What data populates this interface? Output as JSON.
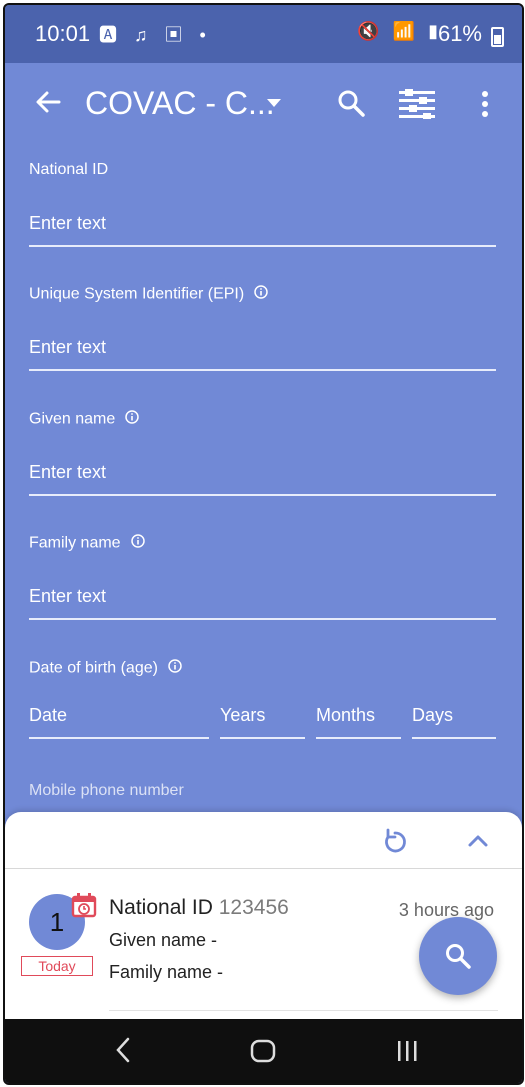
{
  "status": {
    "time": "10:01",
    "left_icons": "🅰 ♫ ▣ •",
    "right_icons": "🔇 📶 ▮",
    "battery": "61%"
  },
  "appbar": {
    "title": "COVAC - C..."
  },
  "form": {
    "fields": [
      {
        "label": "National ID",
        "placeholder": "Enter text"
      },
      {
        "label": "Unique System Identifier (EPI)",
        "placeholder": "Enter text"
      },
      {
        "label": "Given name",
        "placeholder": "Enter text"
      },
      {
        "label": "Family name",
        "placeholder": "Enter text"
      }
    ],
    "dob": {
      "label": "Date of birth (age)",
      "date": "Date",
      "years": "Years",
      "months": "Months",
      "days": "Days"
    },
    "next_label": "Mobile phone number"
  },
  "result": {
    "number": "1",
    "badge": "Today",
    "title_label": "National ID",
    "title_value": "123456",
    "time": "3 hours ago",
    "line1": "Given name  -",
    "line2": "Family name  -"
  },
  "colors": {
    "accent": "#7189d6",
    "statusbar": "#4b63ad",
    "badge": "#e04a5a"
  }
}
